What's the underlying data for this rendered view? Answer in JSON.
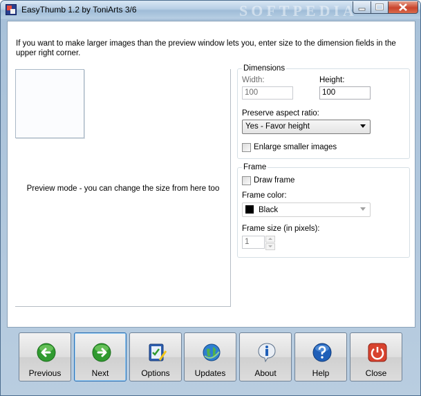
{
  "window": {
    "title": "EasyThumb 1.2 by ToniArts 3/6",
    "watermark": "SOFTPEDIA"
  },
  "intro_text": "If you want to make larger images than the preview window lets you, enter size to the dimension fields in the upper right corner.",
  "preview": {
    "caption": "Preview mode - you can change the size from here too"
  },
  "dimensions": {
    "group_title": "Dimensions",
    "width_label": "Width:",
    "width_value": "100",
    "height_label": "Height:",
    "height_value": "100",
    "aspect_label": "Preserve aspect ratio:",
    "aspect_selected": "Yes - Favor height",
    "enlarge_label": "Enlarge smaller images",
    "enlarge_checked": false
  },
  "frame": {
    "group_title": "Frame",
    "draw_frame_label": "Draw frame",
    "draw_frame_checked": false,
    "color_label": "Frame color:",
    "color_selected": "Black",
    "color_hex": "#000000",
    "size_label": "Frame size (in pixels):",
    "size_value": "1"
  },
  "toolbar": {
    "buttons": [
      {
        "label": "Previous",
        "icon": "left-arrow-icon"
      },
      {
        "label": "Next",
        "icon": "right-arrow-icon"
      },
      {
        "label": "Options",
        "icon": "options-icon"
      },
      {
        "label": "Updates",
        "icon": "globe-icon"
      },
      {
        "label": "About",
        "icon": "info-icon"
      },
      {
        "label": "Help",
        "icon": "help-icon"
      },
      {
        "label": "Close",
        "icon": "power-icon"
      }
    ]
  },
  "colors": {
    "nav_green": "#2f9a2f",
    "info_blue": "#1f5fb8",
    "close_red": "#d8432f"
  }
}
